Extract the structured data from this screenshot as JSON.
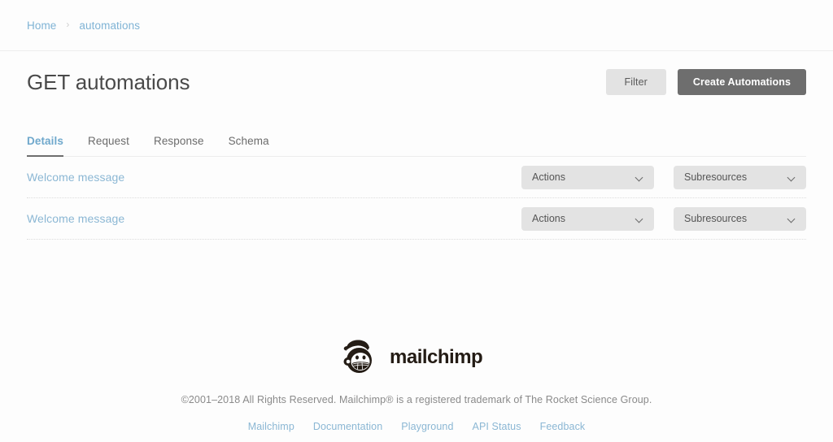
{
  "breadcrumb": {
    "items": [
      {
        "label": "Home"
      },
      {
        "label": "automations"
      }
    ],
    "separator": "›"
  },
  "header": {
    "title": "GET automations",
    "filter_label": "Filter",
    "create_label": "Create Automations"
  },
  "tabs": [
    {
      "label": "Details",
      "active": true
    },
    {
      "label": "Request",
      "active": false
    },
    {
      "label": "Response",
      "active": false
    },
    {
      "label": "Schema",
      "active": false
    }
  ],
  "list": {
    "items": [
      {
        "title": "Welcome message",
        "actions_label": "Actions",
        "subresources_label": "Subresources"
      },
      {
        "title": "Welcome message",
        "actions_label": "Actions",
        "subresources_label": "Subresources"
      }
    ]
  },
  "footer": {
    "logo_text": "mailchimp",
    "copyright": "©2001–2018 All Rights Reserved. Mailchimp® is a registered trademark of The Rocket Science Group.",
    "links": [
      {
        "label": "Mailchimp"
      },
      {
        "label": "Documentation"
      },
      {
        "label": "Playground"
      },
      {
        "label": "API Status"
      },
      {
        "label": "Feedback"
      }
    ]
  },
  "colors": {
    "link_blue": "#8bb7d4",
    "tab_active": "#6fa8cc",
    "button_dark": "#6e6e6e",
    "button_light": "#e3e3e3",
    "text_dark": "#4a4a4a",
    "background": "#fdfdfd"
  }
}
